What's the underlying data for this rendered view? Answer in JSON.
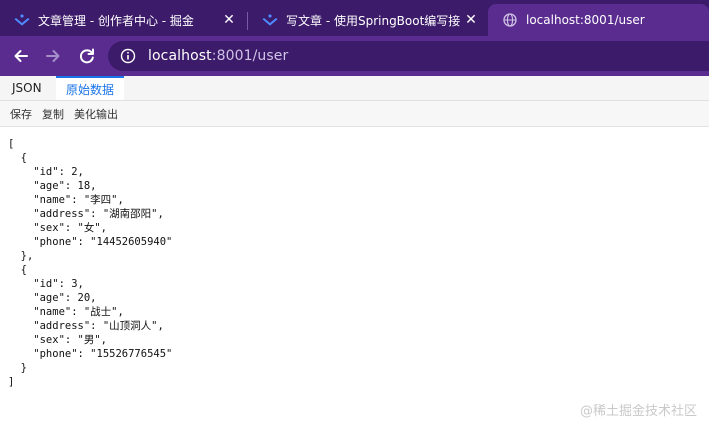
{
  "tabs": [
    {
      "title": "文章管理 - 创作者中心 - 掘金",
      "icon": "juejin-logo-icon",
      "active": false
    },
    {
      "title": "写文章 - 使用SpringBoot编写接",
      "icon": "juejin-logo-icon",
      "active": false
    },
    {
      "title": "localhost:8001/user",
      "icon": "globe-icon",
      "active": true
    }
  ],
  "close_glyph": "✕",
  "address": {
    "host": "localhost",
    "path": ":8001/user"
  },
  "viewer": {
    "tab_json": "JSON",
    "tab_raw": "原始数据",
    "actions": [
      "保存",
      "复制",
      "美化输出"
    ]
  },
  "raw_json": "[\n  {\n    \"id\": 2,\n    \"age\": 18,\n    \"name\": \"李四\",\n    \"address\": \"湖南邵阳\",\n    \"sex\": \"女\",\n    \"phone\": \"14452605940\"\n  },\n  {\n    \"id\": 3,\n    \"age\": 20,\n    \"name\": \"战士\",\n    \"address\": \"山顶洞人\",\n    \"sex\": \"男\",\n    \"phone\": \"15526776545\"\n  }\n]",
  "watermark": "@稀土掘金技术社区",
  "colors": {
    "tabstrip": "#3c1b6a",
    "toolbar": "#5a2c8f",
    "accent": "#1a73e8"
  }
}
